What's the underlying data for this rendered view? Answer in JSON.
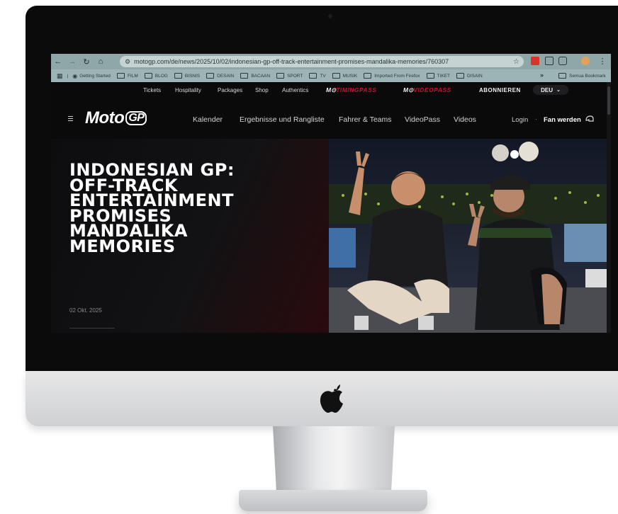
{
  "browser": {
    "url": "motogp.com/de/news/2025/10/02/indonesian-gp-off-track-entertainment-promises-mandalika-memories/760307",
    "bookmarks": [
      "Getting Started",
      "FILM",
      "BLOG",
      "BISNIS",
      "DESAIN",
      "BACAAN",
      "SPORT",
      "TV",
      "MUSIK",
      "Imported From Firefox",
      "TIKET",
      "DISAIN"
    ],
    "bookmarks_overflow": "»",
    "all_bookmarks": "Semua Bookmark"
  },
  "utility_nav": {
    "tickets": "Tickets",
    "hospitality": "Hospitality",
    "packages": "Packages",
    "shop": "Shop",
    "authentics": "Authentics",
    "timingpass_prefix": "M⊙",
    "timingpass": "TIMINGPASS",
    "videopass_prefix": "M⊙",
    "videopass": "VIDEOPASS",
    "subscribe": "ABONNIEREN",
    "language": "DEU"
  },
  "header": {
    "logo_moto": "Moto",
    "logo_gp": "GP",
    "nav": [
      "Kalender",
      "Ergebnisse und Rangliste",
      "Fahrer & Teams",
      "VideoPass",
      "Videos"
    ],
    "login": "Login",
    "separator": "·",
    "fan": "Fan werden"
  },
  "article": {
    "headline_lines": [
      "INDONESIAN GP:",
      "OFF-TRACK",
      "ENTERTAINMENT",
      "PROMISES",
      "MANDALIKA",
      "MEMORIES"
    ],
    "date": "02 Okt. 2025"
  },
  "colors": {
    "chrome": "#8fa7a9",
    "accent_red": "#c9102e",
    "page_bg": "#0a0a0b"
  }
}
